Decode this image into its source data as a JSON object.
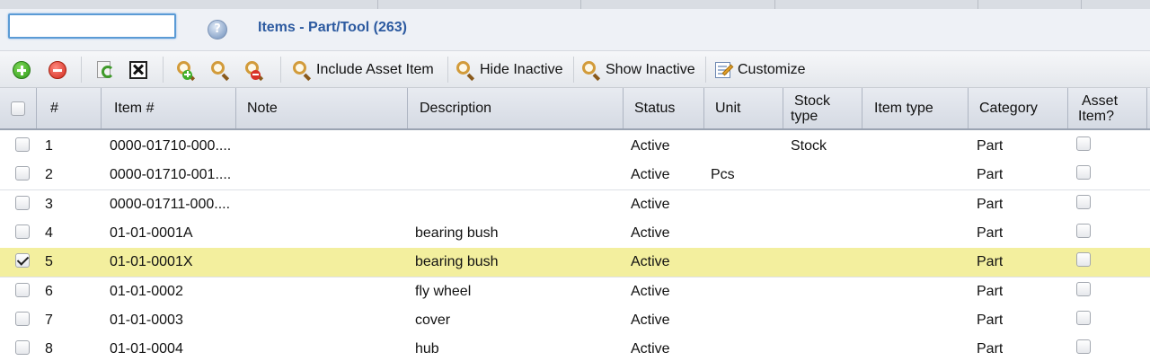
{
  "search": {
    "value": "",
    "placeholder": ""
  },
  "title": "Items - Part/Tool (263)",
  "toolbar": {
    "include_asset_label": "Include Asset Item",
    "hide_inactive_label": "Hide Inactive",
    "show_inactive_label": "Show Inactive",
    "customize_label": "Customize"
  },
  "columns": {
    "num": "#",
    "item": "Item #",
    "note": "Note",
    "description": "Description",
    "status": "Status",
    "unit": "Unit",
    "stock_type_1": "Stock",
    "stock_type_2": "type",
    "item_type": "Item type",
    "category": "Category",
    "asset_1": "Asset",
    "asset_2": "Item?"
  },
  "rows": [
    {
      "num": "1",
      "item": "0000-01710-000....",
      "note": "",
      "description": "",
      "status": "Active",
      "unit": "",
      "stock_type": "Stock",
      "item_type": "",
      "category": "Part",
      "selected": false,
      "asset": false
    },
    {
      "num": "2",
      "item": "0000-01710-001....",
      "note": "",
      "description": "",
      "status": "Active",
      "unit": "Pcs",
      "stock_type": "",
      "item_type": "",
      "category": "Part",
      "selected": false,
      "asset": false
    },
    {
      "num": "3",
      "item": "0000-01711-000....",
      "note": "",
      "description": "",
      "status": "Active",
      "unit": "",
      "stock_type": "",
      "item_type": "",
      "category": "Part",
      "selected": false,
      "asset": false
    },
    {
      "num": "4",
      "item": "01-01-0001A",
      "note": "",
      "description": "bearing bush",
      "status": "Active",
      "unit": "",
      "stock_type": "",
      "item_type": "",
      "category": "Part",
      "selected": false,
      "asset": false
    },
    {
      "num": "5",
      "item": "01-01-0001X",
      "note": "",
      "description": "bearing bush",
      "status": "Active",
      "unit": "",
      "stock_type": "",
      "item_type": "",
      "category": "Part",
      "selected": true,
      "asset": false
    },
    {
      "num": "6",
      "item": "01-01-0002",
      "note": "",
      "description": "fly wheel",
      "status": "Active",
      "unit": "",
      "stock_type": "",
      "item_type": "",
      "category": "Part",
      "selected": false,
      "asset": false
    },
    {
      "num": "7",
      "item": "01-01-0003",
      "note": "",
      "description": "cover",
      "status": "Active",
      "unit": "",
      "stock_type": "",
      "item_type": "",
      "category": "Part",
      "selected": false,
      "asset": false
    },
    {
      "num": "8",
      "item": "01-01-0004",
      "note": "",
      "description": "hub",
      "status": "Active",
      "unit": "",
      "stock_type": "",
      "item_type": "",
      "category": "Part",
      "selected": false,
      "asset": false
    }
  ],
  "colors": {
    "title": "#2c5aa0",
    "selected_row": "#f3ef9e",
    "header_bg": "#d5dae3"
  }
}
